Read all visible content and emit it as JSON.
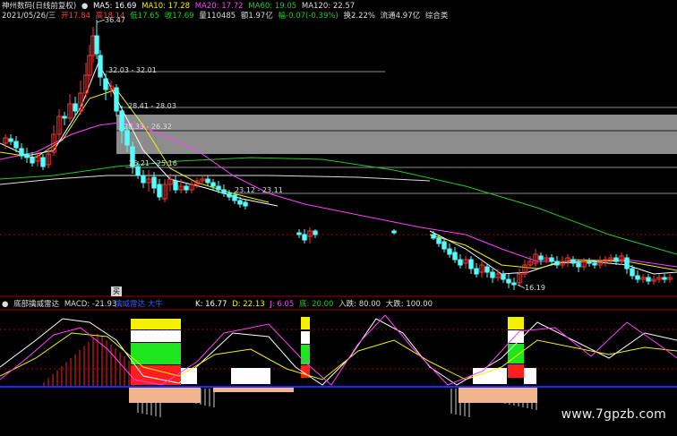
{
  "stock": {
    "name": "神州数码(日线前复权)"
  },
  "ma": [
    {
      "label": "MA5: 16.69",
      "color": "#ffffff"
    },
    {
      "label": "MA10: 17.28",
      "color": "#f2f200"
    },
    {
      "label": "MA20: 17.72",
      "color": "#ff40ff"
    },
    {
      "label": "MA60: 19.05",
      "color": "#22c922"
    },
    {
      "label": "MA120: 22.57",
      "color": "#dcdcdc"
    }
  ],
  "quote": [
    {
      "text": "2021/05/26/三",
      "color": "#dcdcdc"
    },
    {
      "text": "开17.84",
      "color": "#ff4040"
    },
    {
      "text": "高18.14",
      "color": "#ff4040"
    },
    {
      "text": "低17.65",
      "color": "#22c922"
    },
    {
      "text": "收17.69",
      "color": "#22c922"
    },
    {
      "text": "量110485",
      "color": "#dcdcdc"
    },
    {
      "text": "额1.97亿",
      "color": "#dcdcdc"
    },
    {
      "text": "幅-0.07(-0.39%)",
      "color": "#22c922"
    },
    {
      "text": "换2.22%",
      "color": "#dcdcdc"
    },
    {
      "text": "流通4.97亿",
      "color": "#dcdcdc"
    },
    {
      "text": "综合类",
      "color": "#dcdcdc"
    }
  ],
  "price_labels": {
    "high": "36.47",
    "low": "16.19",
    "range1": "32.03 - 32.01",
    "range2": "28.41 - 28.03",
    "range3": "28.33 - 26.32",
    "range4": "25.21 - 25.16",
    "range5": "23.12 - 23.11"
  },
  "crosshair_label": "买",
  "indicator": {
    "name": "底部擒威雷达",
    "macd": "MACD: -21.93",
    "legend": "擒威雷达 大牛",
    "params": [
      {
        "text": "K: 16.77",
        "color": "#ffffff"
      },
      {
        "text": "D: 22.13",
        "color": "#f2f200"
      },
      {
        "text": "J: 6.05",
        "color": "#ff40ff"
      },
      {
        "text": "底: 20.00",
        "color": "#22c922"
      },
      {
        "text": "入跌: 80.00",
        "color": "#dcdcdc"
      },
      {
        "text": "大跌: 100.00",
        "color": "#dcdcdc"
      }
    ]
  },
  "watermark": "www.7gpzb.com",
  "colors": {
    "up": "#ff3232",
    "down": "#54ffff",
    "grid": "#a00000",
    "panel_gray": "#8c8c8c",
    "baseline": "#1e2bff"
  }
}
